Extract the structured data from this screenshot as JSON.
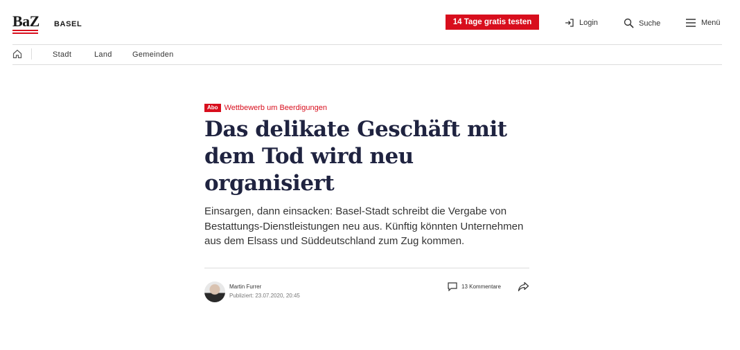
{
  "header": {
    "logo": "BaZ",
    "region": "BASEL",
    "cta_label": "14 Tage gratis testen",
    "login_label": "Login",
    "search_label": "Suche",
    "menu_label": "Menü",
    "accent_color": "#d80e1d"
  },
  "subnav": {
    "items": [
      {
        "label": "Stadt"
      },
      {
        "label": "Land"
      },
      {
        "label": "Gemeinden"
      }
    ]
  },
  "article": {
    "badge": "Abo",
    "kicker": "Wettbewerb um Beerdigungen",
    "headline": "Das delikate Geschäft mit dem Tod wird neu organisiert",
    "lead": "Einsargen, dann einsacken: Basel-Stadt schreibt die Vergabe von Bestattungs-Dienstleistungen neu aus. Künftig könnten Unternehmen aus dem Elsass und Süddeutschland zum Zug kommen.",
    "author": "Martin Furrer",
    "published": "Publiziert: 23.07.2020, 20:45",
    "comments": "13 Kommentare"
  },
  "icons": {
    "home": "home-icon",
    "login": "login-icon",
    "search": "search-icon",
    "menu": "hamburger-icon",
    "comments": "comment-bubble-icon",
    "share": "share-arrow-icon"
  }
}
